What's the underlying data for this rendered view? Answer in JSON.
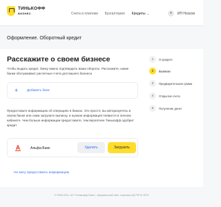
{
  "header": {
    "logo_name": "ТИНЬКОФФ",
    "logo_sub": "БИЗНЕС",
    "nav": [
      {
        "label": "Счета и платежи"
      },
      {
        "label": "Бухгалтерия"
      },
      {
        "label": "Кредиты",
        "active": true
      }
    ],
    "user_name": "ИП Носков",
    "brand_color": "#ffdd2d"
  },
  "page_title": "Оформление. Оборотный кредит",
  "main": {
    "title": "Расскажите о своем бизнесе",
    "description": "Чтобы выдать кредит, банку важно подтвердить ваши обороты. Расскажите, какие банки обслуживают расчетные счета для вашего бизнеса",
    "add_bank_label": "Добавить банк",
    "info_text": "Предоставьте информацию об операциях в банках. Это просто: вы авторизуетесь в своем банке или сами загрузите выписку, и нужная информация появится в личном кабинете. Чем больше информации предоставите, тем вероятнее Тинькофф одобрит кредит",
    "bank": {
      "name": "Альфа-Банк",
      "logo_letter": "А",
      "delete_label": "Удалить",
      "upload_label": "Загрузить"
    },
    "no_info_link": "Не могу предоставить информацию"
  },
  "steps": [
    {
      "num": "1",
      "label": "О кредите",
      "active": false
    },
    {
      "num": "2",
      "label": "Выписки",
      "active": true
    },
    {
      "num": "3",
      "label": "Предварительная сумма",
      "active": false
    },
    {
      "num": "4",
      "label": "Открытие счета",
      "active": false
    },
    {
      "num": "5",
      "label": "Получение денег",
      "active": false
    }
  ],
  "footer": "© 2006-2024, АО «Тинькофф Банк», официальный сайт, лицензия ЦБ РФ № 2673"
}
